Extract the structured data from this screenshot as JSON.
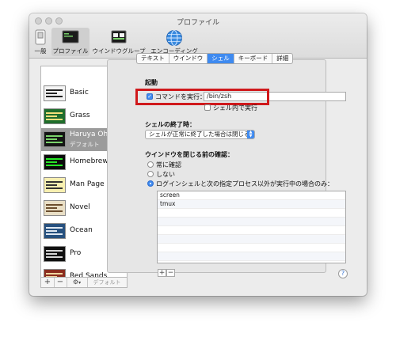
{
  "window": {
    "title": "プロファイル"
  },
  "toolbar": {
    "items": [
      {
        "label": "一般",
        "icon": "general-switch-icon"
      },
      {
        "label": "プロファイル",
        "icon": "terminal-profile-icon",
        "selected": true
      },
      {
        "label": "ウインドウグループ",
        "icon": "window-group-icon"
      },
      {
        "label": "エンコーディング",
        "icon": "globe-icon"
      }
    ]
  },
  "sidebar": {
    "profiles": [
      {
        "name": "Basic",
        "thumb_bg": "#f4f4f4",
        "thumb_fg": "#222222"
      },
      {
        "name": "Grass",
        "thumb_bg": "#1f6d2c",
        "thumb_fg": "#f5e07a"
      },
      {
        "name": "Haruya Ohta...",
        "sub": "デフォルト",
        "thumb_bg": "#141414",
        "thumb_fg": "#7ad36b",
        "selected": true
      },
      {
        "name": "Homebrew",
        "thumb_bg": "#0b0b0b",
        "thumb_fg": "#27e627"
      },
      {
        "name": "Man Page",
        "thumb_bg": "#f8f0b0",
        "thumb_fg": "#333333"
      },
      {
        "name": "Novel",
        "thumb_bg": "#e9dfc6",
        "thumb_fg": "#6b4e2e"
      },
      {
        "name": "Ocean",
        "thumb_bg": "#27517f",
        "thumb_fg": "#dfe8f2"
      },
      {
        "name": "Pro",
        "thumb_bg": "#101010",
        "thumb_fg": "#d6d6d6"
      },
      {
        "name": "Red Sands",
        "thumb_bg": "#8c2d1f",
        "thumb_fg": "#f0d6a0"
      }
    ],
    "add": "+",
    "remove": "−",
    "gear": "⚙",
    "default_button": "デフォルト"
  },
  "tabs": [
    "テキスト",
    "ウインドウ",
    "シェル",
    "キーボード",
    "詳細"
  ],
  "active_tab": "シェル",
  "startup": {
    "heading": "起動",
    "run_command_label": "コマンドを実行：",
    "run_command_checked": true,
    "command_value": "/bin/zsh",
    "run_in_shell_label": "シェル内で実行",
    "run_in_shell_checked": false
  },
  "shell_exit": {
    "heading": "シェルの終了時：",
    "selected_option": "シェルが正常に終了した場合は閉じる"
  },
  "close_confirm": {
    "heading": "ウインドウを閉じる前の確認：",
    "options": [
      "常に確認",
      "しない",
      "ログインシェルと次の指定プロセス以外が実行中の場合のみ："
    ],
    "selected_index": 2,
    "processes": [
      "screen",
      "tmux"
    ]
  },
  "list_controls": {
    "add": "+",
    "remove": "−"
  },
  "help": "?",
  "colors": {
    "accent": "#3e8af0",
    "highlight": "#d0191c"
  }
}
